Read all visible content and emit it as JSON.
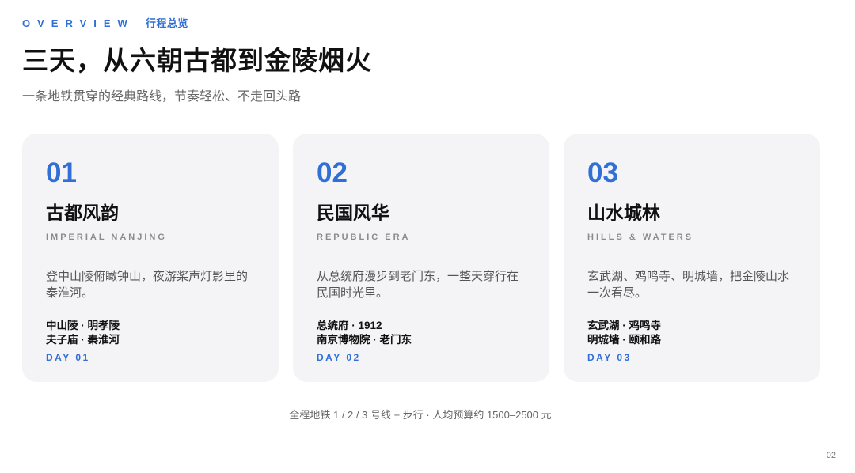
{
  "header": {
    "eyebrow_en": "OVERVIEW",
    "eyebrow_cn": "行程总览",
    "title": "三天，从六朝古都到金陵烟火",
    "subtitle": "一条地铁贯穿的经典路线，节奏轻松、不走回头路"
  },
  "cards": [
    {
      "num": "01",
      "title": "古都风韵",
      "en": "IMPERIAL NANJING",
      "desc": "登中山陵俯瞰钟山，夜游桨声灯影里的秦淮河。",
      "spots": [
        "中山陵 · 明孝陵",
        "夫子庙 · 秦淮河"
      ],
      "day": "DAY 01"
    },
    {
      "num": "02",
      "title": "民国风华",
      "en": "REPUBLIC ERA",
      "desc": "从总统府漫步到老门东，一整天穿行在民国时光里。",
      "spots": [
        "总统府 · 1912",
        "南京博物院 · 老门东"
      ],
      "day": "DAY 02"
    },
    {
      "num": "03",
      "title": "山水城林",
      "en": "HILLS & WATERS",
      "desc": "玄武湖、鸡鸣寺、明城墙，把金陵山水一次看尽。",
      "spots": [
        "玄武湖 · 鸡鸣寺",
        "明城墙 · 颐和路"
      ],
      "day": "DAY 03"
    }
  ],
  "footer": {
    "note": "全程地铁 1 / 2 / 3 号线 + 步行 · 人均预算约 1500–2500 元",
    "page": "02"
  },
  "colors": {
    "accent": "#2f6fd6",
    "card_bg": "#f4f4f6"
  }
}
